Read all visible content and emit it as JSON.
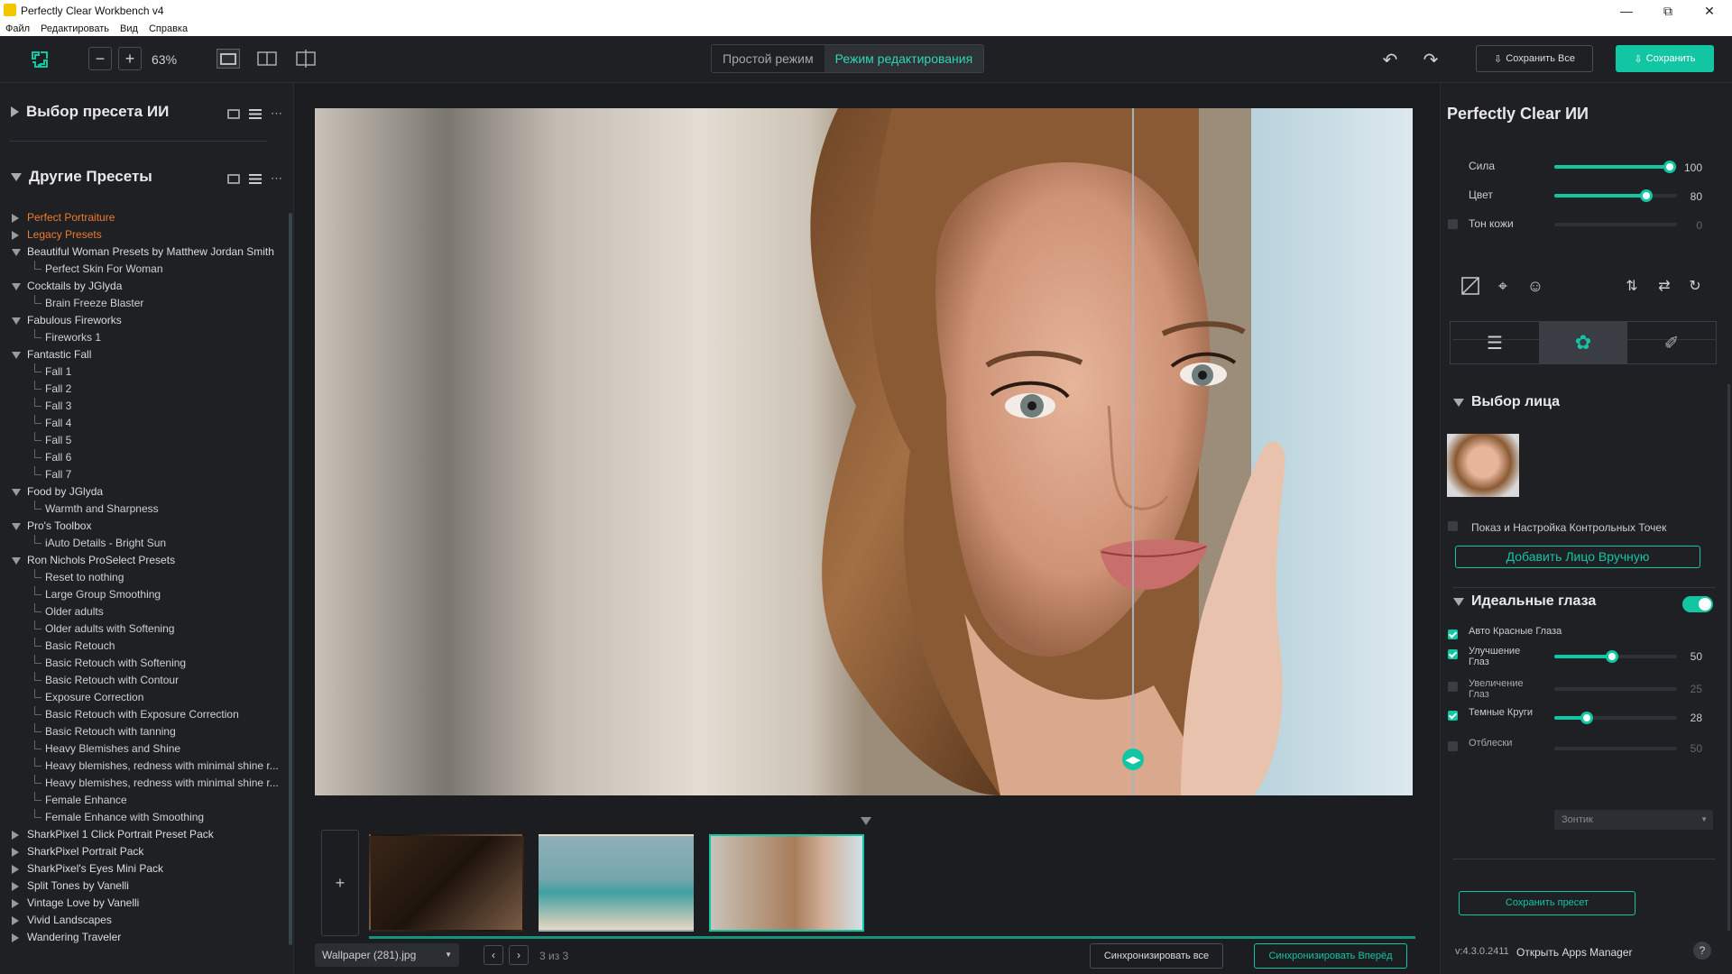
{
  "window": {
    "title": "Perfectly Clear Workbench v4"
  },
  "menu": [
    "Файл",
    "Редактировать",
    "Вид",
    "Справка"
  ],
  "toolbar": {
    "zoom": "63%",
    "mode_simple": "Простой режим",
    "mode_edit": "Режим редактирования",
    "save_all": "Сохранить Все",
    "save": "Сохранить"
  },
  "left": {
    "ai_presets_title": "Выбор пресета ИИ",
    "other_presets_title": "Другие Пресеты",
    "tree": [
      {
        "label": "Perfect Portraiture",
        "level": 0,
        "state": "collapsed",
        "orange": true
      },
      {
        "label": "Legacy Presets",
        "level": 0,
        "state": "collapsed",
        "orange": true
      },
      {
        "label": "Beautiful Woman Presets by Matthew Jordan Smith",
        "level": 0,
        "state": "expanded"
      },
      {
        "label": "Perfect Skin For Woman",
        "level": 1
      },
      {
        "label": "Cocktails by JGlyda",
        "level": 0,
        "state": "expanded"
      },
      {
        "label": "Brain Freeze Blaster",
        "level": 1
      },
      {
        "label": "Fabulous Fireworks",
        "level": 0,
        "state": "expanded"
      },
      {
        "label": "Fireworks 1",
        "level": 1
      },
      {
        "label": "Fantastic Fall",
        "level": 0,
        "state": "expanded"
      },
      {
        "label": "Fall 1",
        "level": 1
      },
      {
        "label": "Fall 2",
        "level": 1
      },
      {
        "label": "Fall 3",
        "level": 1
      },
      {
        "label": "Fall 4",
        "level": 1
      },
      {
        "label": "Fall 5",
        "level": 1
      },
      {
        "label": "Fall 6",
        "level": 1
      },
      {
        "label": "Fall 7",
        "level": 1
      },
      {
        "label": "Food by JGlyda",
        "level": 0,
        "state": "expanded"
      },
      {
        "label": "Warmth and Sharpness",
        "level": 1
      },
      {
        "label": "Pro's Toolbox",
        "level": 0,
        "state": "expanded"
      },
      {
        "label": "iAuto Details - Bright Sun",
        "level": 1
      },
      {
        "label": "Ron Nichols ProSelect Presets",
        "level": 0,
        "state": "expanded"
      },
      {
        "label": "Reset to nothing",
        "level": 1
      },
      {
        "label": "Large Group Smoothing",
        "level": 1
      },
      {
        "label": "Older adults",
        "level": 1
      },
      {
        "label": "Older adults with Softening",
        "level": 1
      },
      {
        "label": "Basic Retouch",
        "level": 1
      },
      {
        "label": "Basic Retouch with Softening",
        "level": 1
      },
      {
        "label": "Basic Retouch with Contour",
        "level": 1
      },
      {
        "label": "Exposure Correction",
        "level": 1
      },
      {
        "label": "Basic Retouch with Exposure Correction",
        "level": 1
      },
      {
        "label": "Basic Retouch with tanning",
        "level": 1
      },
      {
        "label": "Heavy Blemishes and Shine",
        "level": 1
      },
      {
        "label": "Heavy blemishes, redness with minimal shine r...",
        "level": 1
      },
      {
        "label": "Heavy blemishes, redness with minimal shine r...",
        "level": 1
      },
      {
        "label": "Female Enhance",
        "level": 1
      },
      {
        "label": "Female Enhance with Smoothing",
        "level": 1
      },
      {
        "label": "SharkPixel 1 Click Portrait Preset Pack",
        "level": 0,
        "state": "collapsed"
      },
      {
        "label": "SharkPixel Portrait Pack",
        "level": 0,
        "state": "collapsed"
      },
      {
        "label": "SharkPixel's Eyes Mini Pack",
        "level": 0,
        "state": "collapsed"
      },
      {
        "label": "Split Tones by Vanelli",
        "level": 0,
        "state": "collapsed"
      },
      {
        "label": "Vintage Love by Vanelli",
        "level": 0,
        "state": "collapsed"
      },
      {
        "label": "Vivid Landscapes",
        "level": 0,
        "state": "collapsed"
      },
      {
        "label": "Wandering Traveler",
        "level": 0,
        "state": "collapsed"
      }
    ]
  },
  "bottom": {
    "filename": "Wallpaper (281).jpg",
    "count": "3 из 3",
    "sync_all": "Синхронизировать все",
    "sync_forward": "Синхронизировать Вперёд"
  },
  "right": {
    "title": "Perfectly Clear ИИ",
    "sliders": [
      {
        "label": "Сила",
        "value": "100",
        "fraction": 1.0,
        "enabled": true
      },
      {
        "label": "Цвет",
        "value": "80",
        "fraction": 0.8,
        "enabled": true
      },
      {
        "label": "Тон кожи",
        "value": "0",
        "fraction": 0.0,
        "enabled": false
      }
    ],
    "face_section": "Выбор лица",
    "show_points": "Показ и Настройка Контрольных Точек",
    "add_face": "Добавить Лицо Вручную",
    "eyes_section": "Идеальные глаза",
    "eye_controls": [
      {
        "label": "Авто Красные Глаза",
        "checked": true,
        "slider": false
      },
      {
        "label": "Улучшение\nГлаз",
        "checked": true,
        "slider": true,
        "value": "50",
        "fraction": 0.5
      },
      {
        "label": "Увеличение\nГлаз",
        "checked": false,
        "slider": true,
        "value": "25",
        "fraction": 0.25
      },
      {
        "label": "Темные Круги",
        "checked": true,
        "slider": true,
        "value": "28",
        "fraction": 0.28
      },
      {
        "label": "Отблески",
        "checked": false,
        "slider": true,
        "value": "50",
        "fraction": 0.5
      }
    ],
    "catchlight_select": "Зонтик",
    "save_preset": "Сохранить пресет",
    "version": "v:4.3.0.2411",
    "apps_manager": "Открыть Apps Manager",
    "help": "?"
  },
  "colors": {
    "accent": "#12c6a4",
    "orange": "#f07a2e",
    "panel": "#1e2024"
  }
}
